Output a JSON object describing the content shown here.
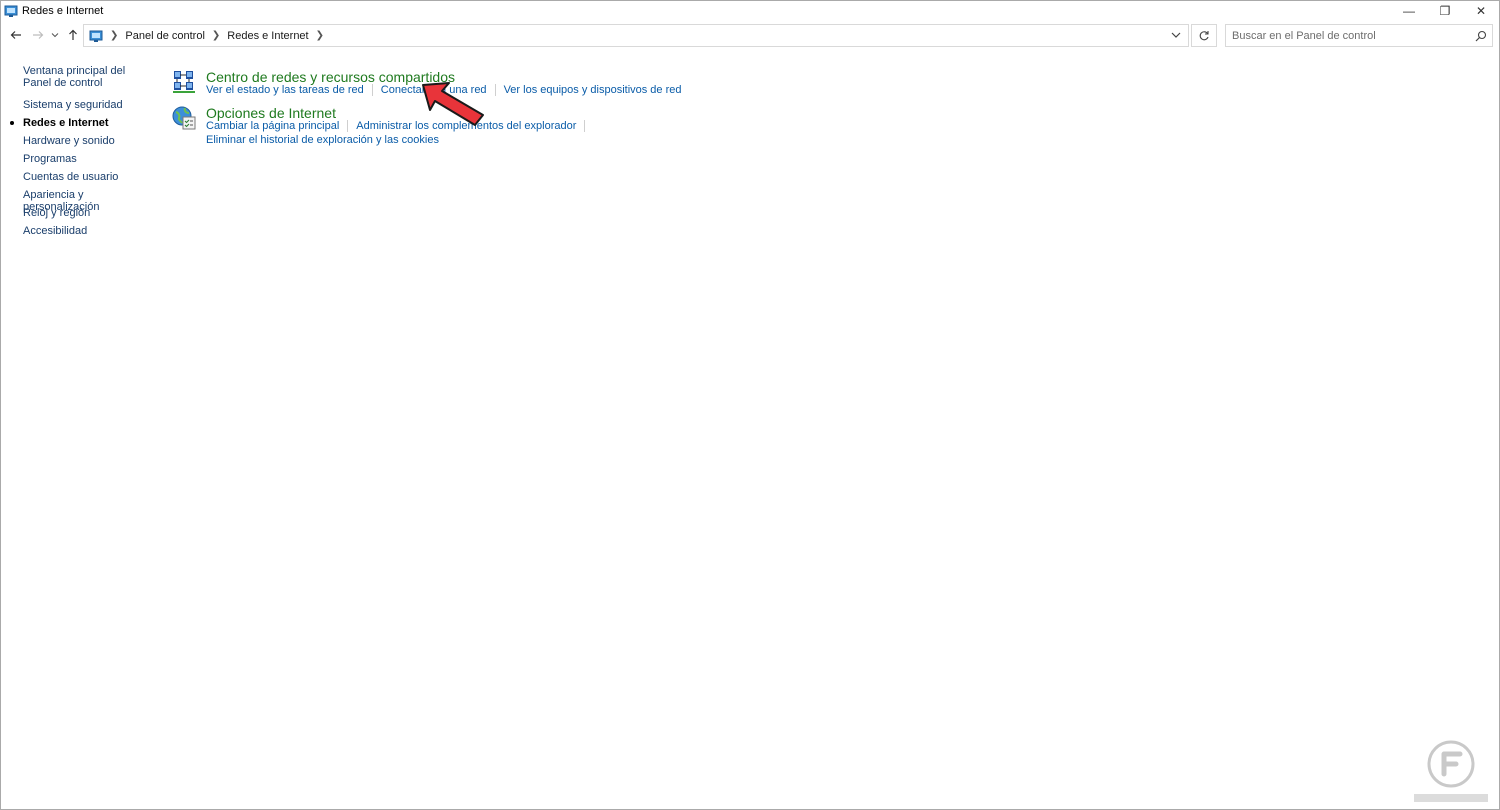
{
  "window": {
    "title": "Redes e Internet",
    "controls": {
      "minimize": "—",
      "restore": "❐",
      "close": "✕"
    }
  },
  "address": {
    "breadcrumb": [
      "Panel de control",
      "Redes e Internet"
    ],
    "search_placeholder": "Buscar en el Panel de control"
  },
  "sidebar": {
    "home": "Ventana principal del Panel de control",
    "items": [
      {
        "label": "Sistema y seguridad",
        "current": false
      },
      {
        "label": "Redes e Internet",
        "current": true
      },
      {
        "label": "Hardware y sonido",
        "current": false
      },
      {
        "label": "Programas",
        "current": false
      },
      {
        "label": "Cuentas de usuario",
        "current": false
      },
      {
        "label": "Apariencia y personalización",
        "current": false
      },
      {
        "label": "Reloj y región",
        "current": false
      },
      {
        "label": "Accesibilidad",
        "current": false
      }
    ]
  },
  "categories": [
    {
      "title": "Centro de redes y recursos compartidos",
      "icon": "network-center-icon",
      "tasks": [
        "Ver el estado y las tareas de red",
        "Conectarse a una red",
        "Ver los equipos y dispositivos de red"
      ]
    },
    {
      "title": "Opciones de Internet",
      "icon": "internet-options-icon",
      "tasks": [
        "Cambiar la página principal",
        "Administrar los complementos del explorador",
        "Eliminar el historial de exploración y las cookies"
      ]
    }
  ],
  "colors": {
    "category_title": "#1f7a1f",
    "task_link": "#0a5ca8",
    "pointer_arrow": "#e8343a"
  }
}
